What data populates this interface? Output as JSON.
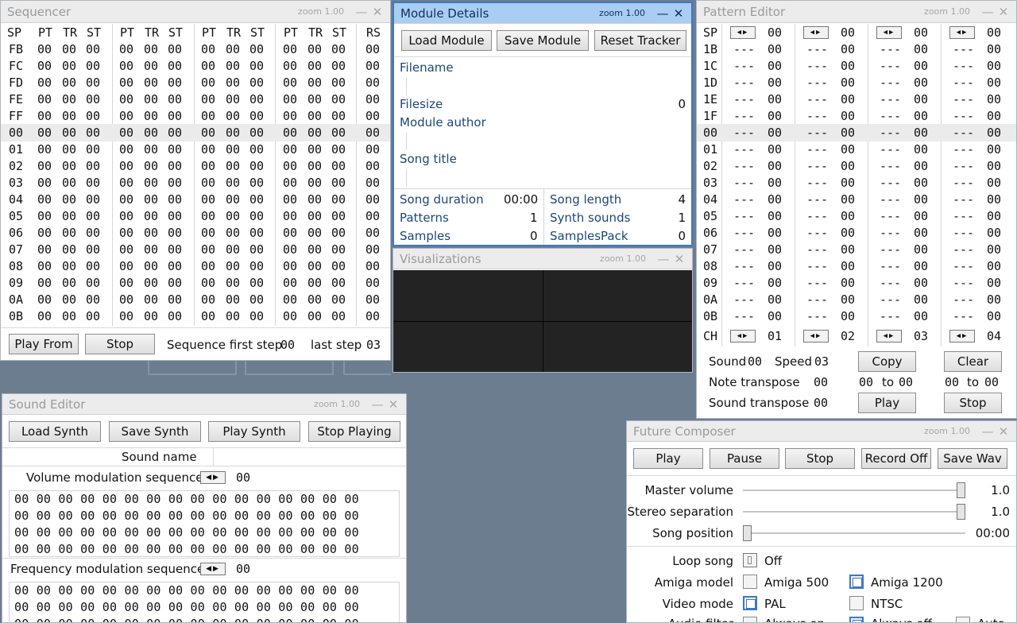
{
  "common": {
    "zoom": "zoom 1.00",
    "min": "—",
    "close": "✕"
  },
  "sequencer": {
    "title": "Sequencer",
    "headers": [
      "SP",
      "PT",
      "TR",
      "ST",
      "PT",
      "TR",
      "ST",
      "PT",
      "TR",
      "ST",
      "PT",
      "TR",
      "ST",
      "RS"
    ],
    "row_labels": [
      "FB",
      "FC",
      "FD",
      "FE",
      "FF",
      "00",
      "01",
      "02",
      "03",
      "04",
      "05",
      "06",
      "07",
      "08",
      "09",
      "0A",
      "0B"
    ],
    "cell": "00",
    "play_from": "Play From",
    "stop": "Stop",
    "first_step_label": "Sequence first step",
    "first_step_value": "00",
    "last_step_label": "last step",
    "last_step_value": "03"
  },
  "module_details": {
    "title": "Module Details",
    "load": "Load Module",
    "save": "Save Module",
    "reset": "Reset Tracker",
    "filename_label": "Filename",
    "filesize_label": "Filesize",
    "filesize_value": "0",
    "author_label": "Module author",
    "song_title_label": "Song title",
    "song_duration_label": "Song duration",
    "song_duration_value": "00:00",
    "song_length_label": "Song length",
    "song_length_value": "4",
    "patterns_label": "Patterns",
    "patterns_value": "1",
    "synth_sounds_label": "Synth sounds",
    "synth_sounds_value": "1",
    "samples_label": "Samples",
    "samples_value": "0",
    "samplespack_label": "SamplesPack",
    "samplespack_value": "0"
  },
  "visualizations": {
    "title": "Visualizations"
  },
  "pattern_editor": {
    "title": "Pattern Editor",
    "sp_label": "SP",
    "ch_label": "CH",
    "row_labels": [
      "1B",
      "1C",
      "1D",
      "1E",
      "1F",
      "00",
      "01",
      "02",
      "03",
      "04",
      "05",
      "06",
      "07",
      "08",
      "09",
      "0A",
      "0B"
    ],
    "note": "---",
    "val": "00",
    "arrows": "◀▶",
    "header_values": [
      "00",
      "00",
      "00",
      "00"
    ],
    "channels": [
      "01",
      "02",
      "03",
      "04"
    ],
    "sound_label": "Sound",
    "sound_value": "00",
    "speed_label": "Speed",
    "speed_value": "03",
    "note_transpose_label": "Note transpose",
    "note_transpose_value": "00",
    "sound_transpose_label": "Sound transpose",
    "sound_transpose_value": "00",
    "range1_from": "00",
    "range1_to": "00",
    "range2_from": "00",
    "range2_to": "00",
    "to_label": "to",
    "copy": "Copy",
    "clear": "Clear",
    "play": "Play",
    "stop": "Stop"
  },
  "sound_editor": {
    "title": "Sound Editor",
    "load": "Load Synth",
    "save": "Save Synth",
    "play": "Play Synth",
    "stop": "Stop Playing",
    "sound_name_label": "Sound name",
    "vol_label": "Volume modulation sequence",
    "vol_value": "00",
    "freq_label": "Frequency modulation sequence",
    "freq_value": "00",
    "seq_line": "00 00 00 00 00 00 00 00 00 00 00 00 00 00 00 00",
    "arrows": "◀▶"
  },
  "future_composer": {
    "title": "Future Composer",
    "play": "Play",
    "pause": "Pause",
    "stop": "Stop",
    "record": "Record Off",
    "save_wav": "Save Wav",
    "master_volume_label": "Master volume",
    "master_volume_value": "1.0",
    "master_volume_level": 1.0,
    "stereo_label": "Stereo separation",
    "stereo_value": "1.0",
    "stereo_level": 1.0,
    "song_pos_label": "Song position",
    "song_pos_value": "00:00",
    "song_pos_level": 0.0,
    "loop_label": "Loop song",
    "loop_value": "Off",
    "amiga_label": "Amiga model",
    "amiga500": "Amiga 500",
    "amiga1200": "Amiga 1200",
    "video_label": "Video mode",
    "pal": "PAL",
    "ntsc": "NTSC",
    "audio_filter_label": "Audio filter",
    "always_on": "Always on",
    "always_off": "Always off",
    "auto": "Auto"
  }
}
